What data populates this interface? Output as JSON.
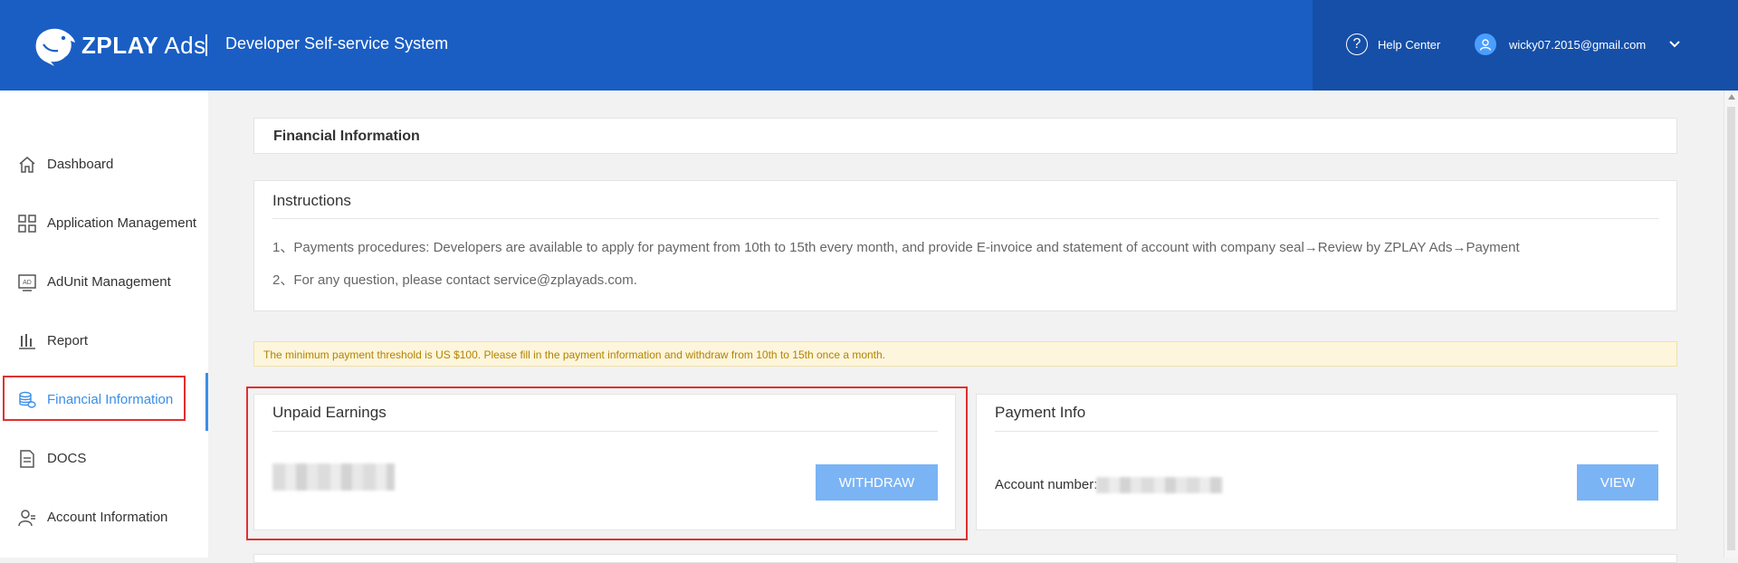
{
  "header": {
    "brand": "ZPLAY",
    "brand_suffix": "Ads",
    "system_title": "Developer Self-service System",
    "help_label": "Help Center",
    "user_email": "wicky07.2015@gmail.com",
    "help_icon_glyph": "?"
  },
  "sidebar": {
    "items": [
      {
        "label": "Dashboard",
        "icon": "home-icon"
      },
      {
        "label": "Application Management",
        "icon": "grid-icon"
      },
      {
        "label": "AdUnit Management",
        "icon": "ad-icon"
      },
      {
        "label": "Report",
        "icon": "bar-chart-icon"
      },
      {
        "label": "Financial Information",
        "icon": "coins-icon",
        "active": true
      },
      {
        "label": "DOCS",
        "icon": "document-icon"
      },
      {
        "label": "Account Information",
        "icon": "account-icon"
      }
    ]
  },
  "main": {
    "page_title": "Financial Information",
    "instructions": {
      "title": "Instructions",
      "line1": "1、Payments procedures: Developers are available to apply for payment from 10th to 15th every month, and provide E-invoice and statement of account with company seal→Review by ZPLAY Ads→Payment",
      "line2": "2、For any question, please contact service@zplayads.com."
    },
    "notice": "The minimum payment threshold is US $100. Please fill in the payment information and withdraw from 10th to 15th once a month.",
    "unpaid": {
      "title": "Unpaid Earnings",
      "button": "WITHDRAW"
    },
    "payment": {
      "title": "Payment Info",
      "account_label": "Account number:",
      "button": "VIEW"
    }
  },
  "colors": {
    "header": "#1a5ec4",
    "header_right": "#154fa8",
    "accent": "#3b8ee8",
    "button": "#7ab4f5",
    "highlight": "#e03030",
    "notice_text": "#b38300"
  }
}
